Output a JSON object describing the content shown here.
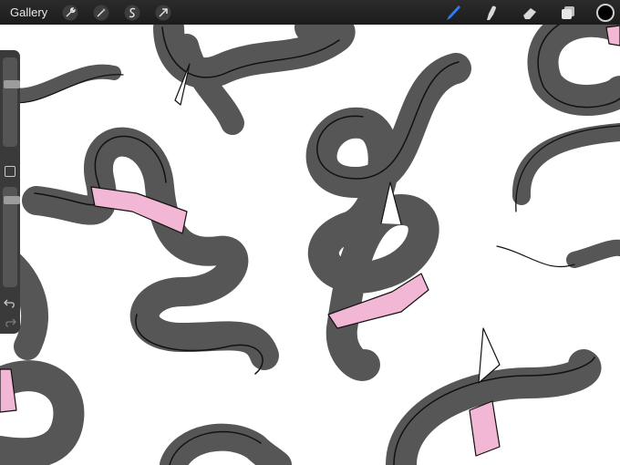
{
  "toolbar": {
    "gallery_label": "Gallery",
    "left_tools": [
      "wrench-icon",
      "magic-wand-icon",
      "selection-icon",
      "transform-arrow-icon"
    ],
    "right_tools": [
      "brush-icon",
      "smudge-icon",
      "eraser-icon",
      "layers-icon"
    ],
    "active_tool": "brush-icon",
    "accent_color": "#2f7cf6",
    "current_color": "#000000"
  },
  "sidebar": {
    "brush_size_level": 0.28,
    "opacity_level": 0.1,
    "undo_icon": "undo-icon",
    "redo_icon": "redo-icon"
  },
  "artwork": {
    "snake_fill": "#565656",
    "outline": "#111111",
    "band_fill": "#f3b7d6",
    "background": "#ffffff"
  }
}
